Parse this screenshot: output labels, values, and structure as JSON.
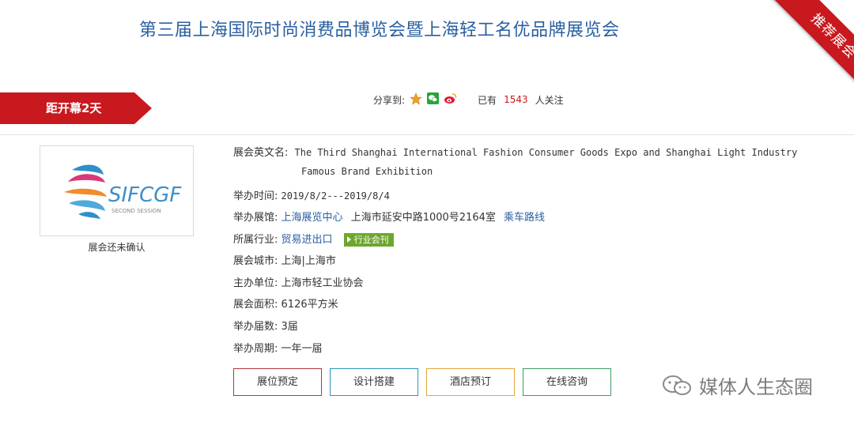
{
  "page": {
    "title": "第三届上海国际时尚消费品博览会暨上海轻工名优品牌展览会",
    "ribbon": "推荐展会",
    "countdown": "距开幕2天"
  },
  "share": {
    "label": "分享到:",
    "icons": [
      "star-icon",
      "wechat-icon",
      "weibo-icon"
    ],
    "views_prefix": "已有",
    "views_count": "1543",
    "views_suffix": "人关注"
  },
  "logo": {
    "text": "SIFCGF",
    "subtext": "SECOND SESSION",
    "caption": "展会还未确认"
  },
  "info": {
    "en_name_label": "展会英文名:",
    "en_name_line1": "The Third Shanghai International Fashion Consumer Goods Expo and Shanghai Light Industry",
    "en_name_line2": "Famous Brand Exhibition",
    "time_label": "举办时间:",
    "time_value": "2019/8/2---2019/8/4",
    "venue_label": "举办展馆:",
    "venue_name": "上海展览中心",
    "venue_address": "上海市延安中路1000号2164室",
    "venue_route": "乘车路线",
    "industry_label": "所属行业:",
    "industry_value": "贸易进出口",
    "industry_badge": "行业会刊",
    "city_label": "展会城市:",
    "city_value": "上海|上海市",
    "organizer_label": "主办单位:",
    "organizer_value": "上海市轻工业协会",
    "area_label": "展会面积:",
    "area_value": "6126平方米",
    "sessions_label": "举办届数:",
    "sessions_value": "3届",
    "cycle_label": "举办周期:",
    "cycle_value": "一年一届"
  },
  "buttons": {
    "booth": "展位预定",
    "design": "设计搭建",
    "hotel": "酒店预订",
    "consult": "在线咨询"
  },
  "watermark": "媒体人生态圈",
  "colors": {
    "brand_red": "#c8191f",
    "title_blue": "#2a5fa0",
    "badge_green": "#6ea72d"
  }
}
